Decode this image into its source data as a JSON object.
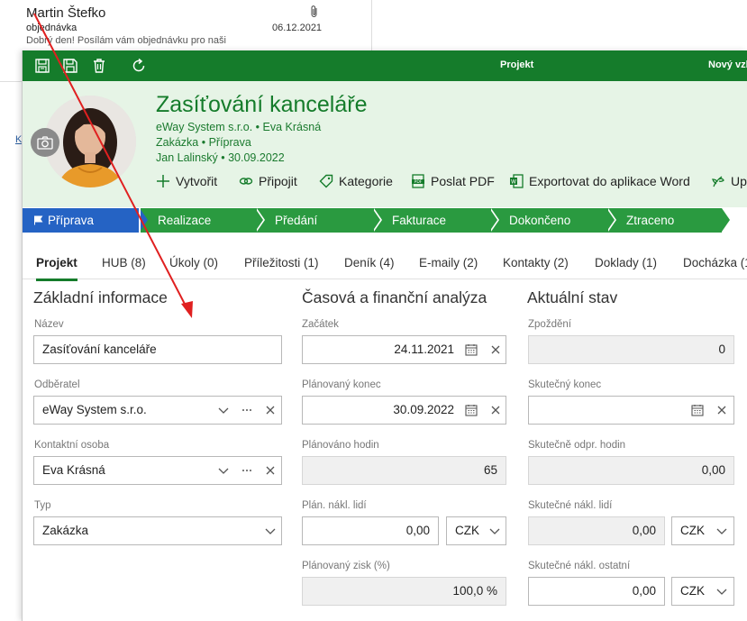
{
  "email": {
    "sender": "Martin Štefko",
    "subject": "objednávka",
    "preview": "Dobrý den!  Posílám vám objednávku pro naši",
    "date": "06.12.2021",
    "link_char": "K"
  },
  "toolbar": {
    "title": "Projekt",
    "new_label": "Nový vzh"
  },
  "project": {
    "title": "Zasíťování kanceláře",
    "line1": "eWay System s.r.o. • Eva Krásná",
    "line2": "Zakázka • Příprava",
    "line3": "Jan Lalinský • 30.09.2022"
  },
  "actions": {
    "create": "Vytvořit",
    "connect": "Připojit",
    "category": "Kategorie",
    "send_pdf": "Poslat PDF",
    "export_word": "Exportovat do aplikace Word",
    "up": "Up"
  },
  "stages": [
    "Příprava",
    "Realizace",
    "Předání",
    "Fakturace",
    "Dokončeno",
    "Ztraceno"
  ],
  "tabs": [
    "Projekt",
    "HUB (8)",
    "Úkoly (0)",
    "Příležitosti (1)",
    "Deník (4)",
    "E-maily (2)",
    "Kontakty (2)",
    "Doklady (1)",
    "Docházka (1"
  ],
  "basic": {
    "section": "Základní informace",
    "name_label": "Název",
    "name_value": "Zasíťování kanceláře",
    "customer_label": "Odběratel",
    "customer_value": "eWay System s.r.o.",
    "contact_label": "Kontaktní osoba",
    "contact_value": "Eva Krásná",
    "type_label": "Typ",
    "type_value": "Zakázka"
  },
  "time": {
    "section": "Časová a finanční analýza",
    "start_label": "Začátek",
    "start_value": "24.11.2021",
    "planned_end_label": "Plánovaný konec",
    "planned_end_value": "30.09.2022",
    "planned_hours_label": "Plánováno hodin",
    "planned_hours_value": "65",
    "plan_cost_label": "Plán. nákl. lidí",
    "plan_cost_value": "0,00",
    "plan_cost_currency": "CZK",
    "planned_profit_label": "Plánovaný zisk (%)",
    "planned_profit_value": "100,0 %"
  },
  "status": {
    "section": "Aktuální stav",
    "delay_label": "Zpoždění",
    "delay_value": "0",
    "actual_end_label": "Skutečný konec",
    "actual_hours_label": "Skutečně odpr. hodin",
    "actual_hours_value": "0,00",
    "actual_cost_label": "Skutečné nákl. lidí",
    "actual_cost_value": "0,00",
    "actual_cost_currency": "CZK",
    "actual_other_label": "Skutečné nákl. ostatní",
    "actual_other_value": "0,00",
    "actual_other_currency": "CZK"
  },
  "colors": {
    "brand_green": "#157c2b",
    "stage_green": "#2a9a40",
    "stage_active": "#2563c4",
    "header_bg": "#e6f4e6",
    "arrow_red": "#e02020"
  }
}
